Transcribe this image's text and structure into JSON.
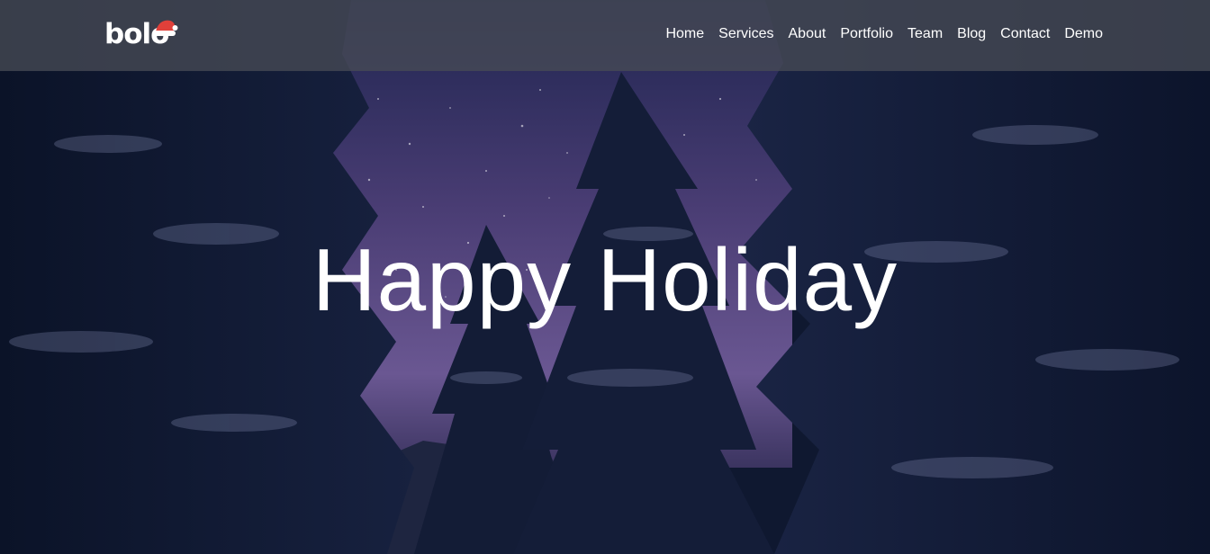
{
  "brand": {
    "logo_text": "bolo",
    "logo_icon": "santa-hat-icon"
  },
  "nav": {
    "items": [
      {
        "label": "Home"
      },
      {
        "label": "Services"
      },
      {
        "label": "About"
      },
      {
        "label": "Portfolio"
      },
      {
        "label": "Team"
      },
      {
        "label": "Blog"
      },
      {
        "label": "Contact"
      },
      {
        "label": "Demo"
      }
    ]
  },
  "hero": {
    "title": "Happy Holiday",
    "background": "snowy-pine-forest-night-sky-image"
  },
  "colors": {
    "text": "#ffffff",
    "navbar_bg": "#464a54",
    "hat_red": "#e0403a",
    "sky_purple": "#5b4a82",
    "forest_dark": "#101a33"
  }
}
